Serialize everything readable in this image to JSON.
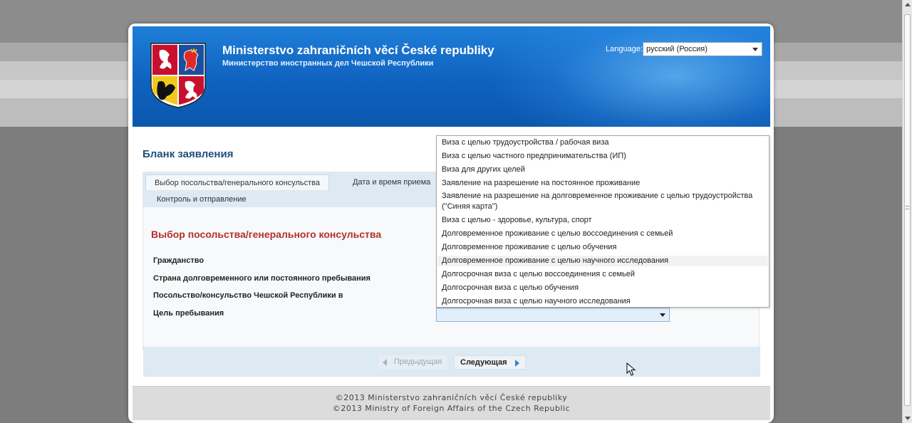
{
  "header": {
    "ministry_cz": "Ministerstvo zahraničních věcí České republiky",
    "ministry_ru": "Министерство иностранных дел Чешской Республики",
    "language_label": "Language:",
    "language_value": "русский (Россия)"
  },
  "form": {
    "title": "Бланк заявления",
    "tabs": [
      {
        "label": "Выбор посольства/генерального консульства",
        "active": true
      },
      {
        "label": "Дата и время приема",
        "active": false
      },
      {
        "label": "Контроль и отправление",
        "active": false
      }
    ],
    "section_title": "Выбор посольства/генерального консульства",
    "fields": {
      "citizenship": "Гражданство",
      "residence_country": "Страна долговременного или постоянного пребывания",
      "embassy": "Посольство/консульство Чешской Республики в",
      "purpose": "Цель пребывания"
    },
    "purpose_value": ""
  },
  "dropdown": {
    "options": [
      "Виза с целью трудоустройства / рабочая виза",
      "Виза с целью частного предпринимательства (ИП)",
      "Виза для других целей",
      "Заявление на разрешение на постоянное проживание",
      "Заявление на разрешение на долговременное проживание с целью трудоустройства",
      "(\"Синяя карта\")",
      "Виза с целью - здоровье, культура, спорт",
      "Долговременное проживание с целью воссоединения с семьей",
      "Долговременное проживание с целью обучения",
      "Долговременное проживание с целью научного исследования",
      "Долгосрочная виза с целью воссоединения с семьей",
      "Долгосрочная виза с целью обучения",
      "Долгосрочная виза с целью научного исследования"
    ],
    "highlighted_index": 9
  },
  "nav": {
    "prev_label": "Предыдущая",
    "next_label": "Следующая"
  },
  "footer": {
    "line_cz": "©2013 Ministerstvo zahraničních věcí České republiky",
    "line_en": "©2013 Ministry of Foreign Affairs of the Czech Republic"
  },
  "colors": {
    "header_blue": "#0f62bf",
    "title_blue": "#1e4f7d",
    "section_red": "#b3302b",
    "tab_bg": "#dde9f3"
  }
}
